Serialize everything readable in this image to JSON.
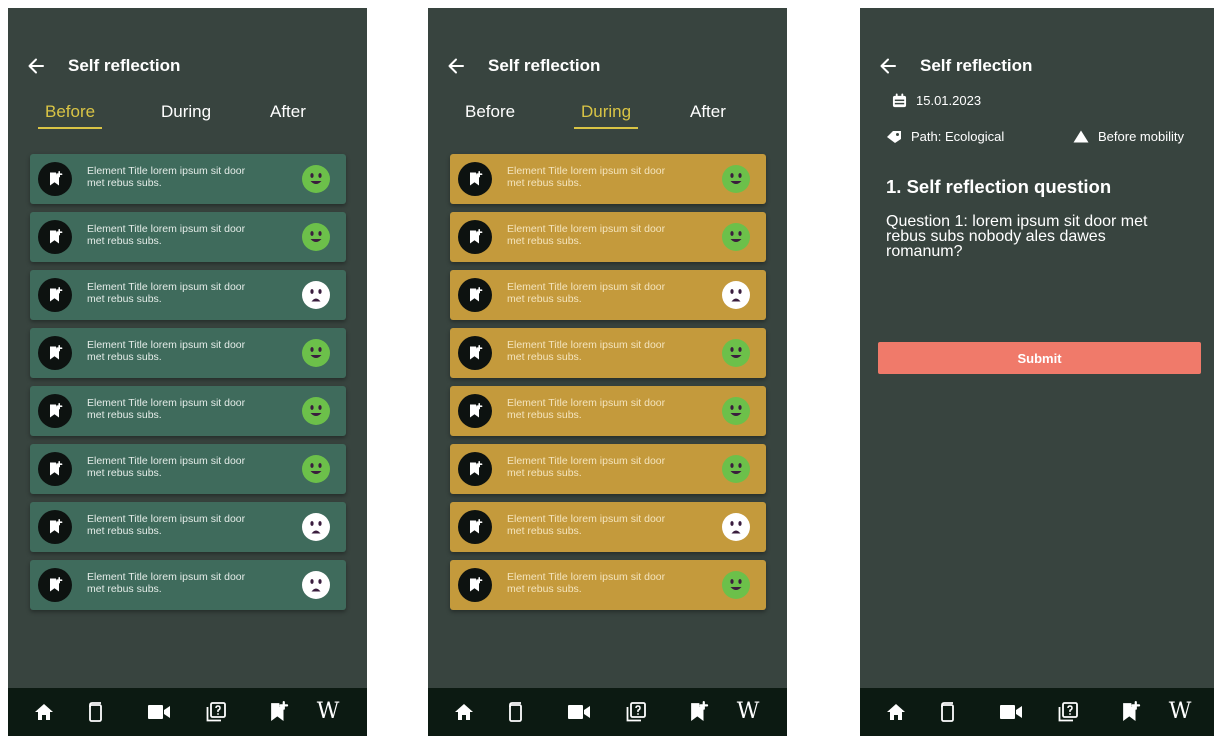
{
  "header": {
    "title": "Self reflection"
  },
  "tabs": {
    "before": "Before",
    "during": "During",
    "after": "After"
  },
  "screen1": {
    "active_tab": "Before",
    "items": [
      {
        "text": "Element Title lorem ipsum sit door met rebus subs.",
        "mood": "happy"
      },
      {
        "text": "Element Title lorem ipsum sit door met rebus subs.",
        "mood": "happy"
      },
      {
        "text": "Element Title lorem ipsum sit door met rebus subs.",
        "mood": "sad"
      },
      {
        "text": "Element Title lorem ipsum sit door met rebus subs.",
        "mood": "happy"
      },
      {
        "text": "Element Title lorem ipsum sit door met rebus subs.",
        "mood": "happy"
      },
      {
        "text": "Element Title lorem ipsum sit door met rebus subs.",
        "mood": "happy"
      },
      {
        "text": "Element Title lorem ipsum sit door met rebus subs.",
        "mood": "sad"
      },
      {
        "text": "Element Title lorem ipsum sit door met rebus subs.",
        "mood": "sad"
      }
    ]
  },
  "screen2": {
    "active_tab": "During",
    "items": [
      {
        "text": "Element Title lorem ipsum sit door met rebus subs.",
        "mood": "happy"
      },
      {
        "text": "Element Title lorem ipsum sit door met rebus subs.",
        "mood": "happy"
      },
      {
        "text": "Element Title lorem ipsum sit door met rebus subs.",
        "mood": "sad"
      },
      {
        "text": "Element Title lorem ipsum sit door met rebus subs.",
        "mood": "happy"
      },
      {
        "text": "Element Title lorem ipsum sit door met rebus subs.",
        "mood": "happy"
      },
      {
        "text": "Element Title lorem ipsum sit door met rebus subs.",
        "mood": "happy"
      },
      {
        "text": "Element Title lorem ipsum sit door met rebus subs.",
        "mood": "sad"
      },
      {
        "text": "Element Title lorem ipsum sit door met rebus subs.",
        "mood": "happy"
      }
    ]
  },
  "screen3": {
    "date": "15.01.2023",
    "path": "Path: Ecological",
    "phase": "Before mobility",
    "question_title": "1. Self reflection question",
    "question_text": "Question 1: lorem ipsum sit door met rebus subs nobody ales dawes romanum?",
    "submit_label": "Submit"
  },
  "nav": {
    "items": [
      "home-icon",
      "book-icon",
      "video-icon",
      "quiz-icon",
      "bookmark-add-icon",
      "wikipedia-icon"
    ],
    "wiki_label": "W"
  },
  "colors": {
    "screen_bg": "#38443f",
    "card_green": "#3f6b5c",
    "card_gold": "#c49a3c",
    "tab_active": "#d9c445",
    "happy_face": "#6cc04a",
    "sad_face": "#ffffff",
    "submit": "#f07a6a",
    "nav_bg": "#0c1a12"
  }
}
